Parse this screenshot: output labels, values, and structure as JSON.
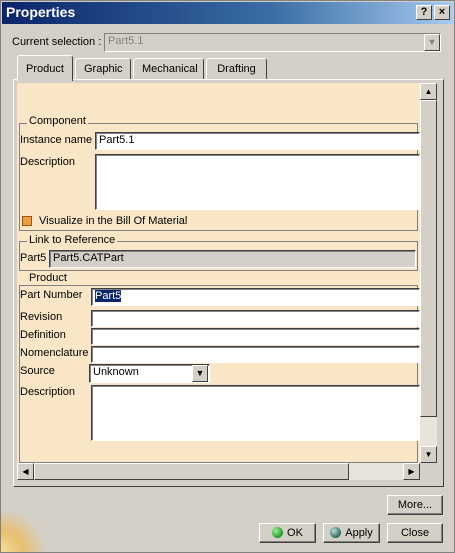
{
  "window": {
    "title": "Properties"
  },
  "titlebar_buttons": {
    "help": "?",
    "close": "×"
  },
  "selection": {
    "label": "Current selection :",
    "value": "Part5.1"
  },
  "tabs": [
    {
      "label": "Product",
      "active": true
    },
    {
      "label": "Graphic",
      "active": false
    },
    {
      "label": "Mechanical",
      "active": false
    },
    {
      "label": "Drafting",
      "active": false
    }
  ],
  "component": {
    "group_title": "Component",
    "instance_name_label": "Instance name",
    "instance_name_value": "Part5.1",
    "description_label": "Description",
    "description_value": "",
    "visualize_label": "Visualize in the Bill Of Material"
  },
  "link": {
    "group_title": "Link to Reference",
    "label": "Part5",
    "value": "Part5.CATPart"
  },
  "product": {
    "group_title": "Product",
    "part_number_label": "Part Number",
    "part_number_value": "Part5",
    "revision_label": "Revision",
    "revision_value": "",
    "definition_label": "Definition",
    "definition_value": "",
    "nomenclature_label": "Nomenclature",
    "nomenclature_value": "",
    "source_label": "Source",
    "source_value": "Unknown",
    "description_label": "Description",
    "description_value": ""
  },
  "buttons": {
    "more": "More...",
    "ok": "OK",
    "apply": "Apply",
    "close": "Close"
  },
  "colors": {
    "title_bar": "#0a246a",
    "panel_background": "#f9e6c6",
    "ok_icon": "#1e9a1e",
    "apply_icon": "#2a6a5a"
  }
}
